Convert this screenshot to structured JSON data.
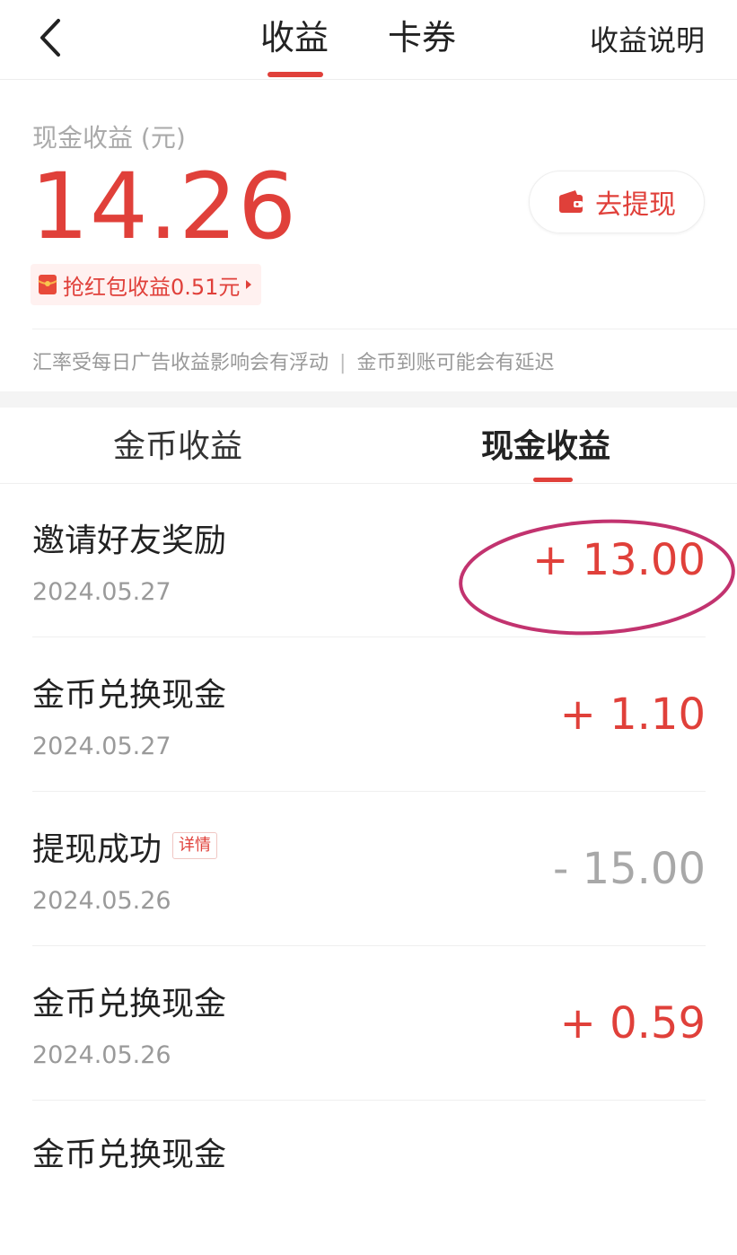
{
  "nav": {
    "tab_earnings": "收益",
    "tab_coupons": "卡券",
    "explain_link": "收益说明"
  },
  "summary": {
    "label": "现金收益 (元)",
    "amount": "14.26",
    "withdraw_label": "去提现",
    "redpacket_text": "抢红包收益0.51元",
    "notice_left": "汇率受每日广告收益影响会有浮动",
    "notice_sep": "|",
    "notice_right": "金币到账可能会有延迟"
  },
  "subtabs": {
    "coin": "金币收益",
    "cash": "现金收益"
  },
  "records": [
    {
      "title": "邀请好友奖励",
      "date": "2024.05.27",
      "amount": "+ 13.00"
    },
    {
      "title": "金币兑换现金",
      "date": "2024.05.27",
      "amount": "+ 1.10"
    },
    {
      "title": "提现成功",
      "tag": "详情",
      "date": "2024.05.26",
      "amount": "- 15.00"
    },
    {
      "title": "金币兑换现金",
      "date": "2024.05.26",
      "amount": "+ 0.59"
    },
    {
      "title": "金币兑换现金",
      "date": "",
      "amount": ""
    }
  ],
  "colors": {
    "accent": "#e0403a",
    "muted_text": "#9a9a9a",
    "annotation_circle": "#c2336f"
  },
  "icons": {
    "back": "chevron-left-icon",
    "wallet": "wallet-icon",
    "redpacket": "red-envelope-icon",
    "arrow": "caret-right-icon"
  }
}
